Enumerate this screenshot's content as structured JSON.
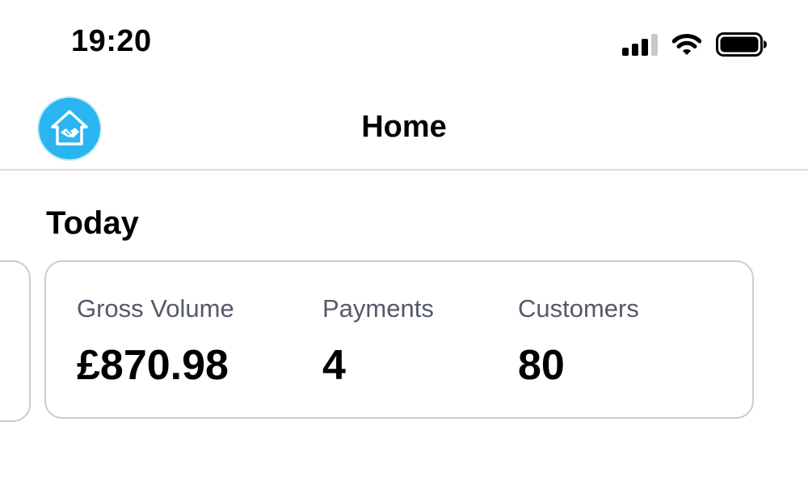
{
  "status_bar": {
    "time": "19:20",
    "icons": [
      "cellular-signal-icon",
      "wifi-icon",
      "battery-icon"
    ]
  },
  "nav": {
    "logo_icon": "house-handshake-icon",
    "title": "Home",
    "accent_color": "#29b6f0"
  },
  "today": {
    "title": "Today",
    "stats": [
      {
        "label": "Gross Volume",
        "value": "£870.98"
      },
      {
        "label": "Payments",
        "value": "4"
      },
      {
        "label": "Customers",
        "value": "80"
      }
    ]
  }
}
